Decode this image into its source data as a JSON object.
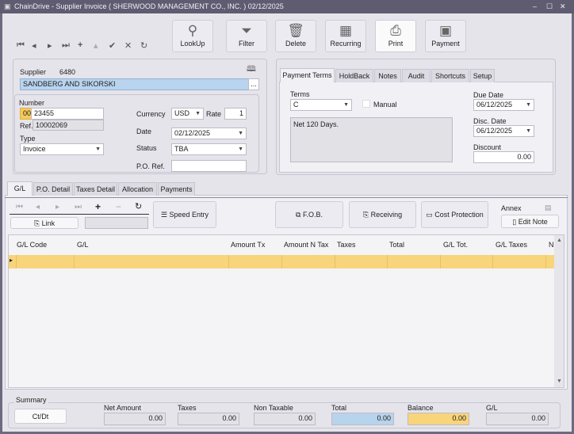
{
  "window": {
    "title": "ChainDrive - Supplier Invoice ( SHERWOOD MANAGEMENT CO., INC. ) 02/12/2025",
    "controls": [
      "–",
      "☐",
      "✕"
    ]
  },
  "toolbar": {
    "nav_icons": [
      "first",
      "previous",
      "next",
      "last",
      "add",
      "up",
      "confirm",
      "cancel",
      "refresh"
    ],
    "nav_glyphs": [
      "⏮",
      "◂",
      "▸",
      "⏭",
      "+",
      "▴",
      "✔",
      "✕",
      "↻"
    ],
    "buttons": [
      {
        "label": "LookUp",
        "icon": "search-icon",
        "glyph": "⚲"
      },
      {
        "label": "Filter",
        "icon": "filter-icon",
        "glyph": "⏷"
      },
      {
        "label": "Delete",
        "icon": "trash-icon",
        "glyph": "🗑"
      },
      {
        "label": "Recurring",
        "icon": "calendar-icon",
        "glyph": "▦"
      },
      {
        "label": "Print",
        "icon": "printer-icon",
        "glyph": "⎙"
      },
      {
        "label": "Payment",
        "icon": "payment-icon",
        "glyph": "▣"
      }
    ]
  },
  "supplier": {
    "label": "Supplier",
    "code": "6480",
    "name": "SANDBERG AND SIKORSKI",
    "browse": "..."
  },
  "invoice": {
    "number_label": "Number",
    "prefix": "00",
    "number": "23455",
    "ref_label": "Ref.",
    "ref": "10002069",
    "type_label": "Type",
    "type": "Invoice",
    "currency_label": "Currency",
    "currency": "USD",
    "rate_label": "Rate",
    "rate": "1",
    "date_label": "Date",
    "date": "02/12/2025",
    "status_label": "Status",
    "status": "TBA",
    "po_ref_label": "P.O. Ref.",
    "po_ref": ""
  },
  "top_tabs": [
    "Payment Terms",
    "HoldBack",
    "Notes",
    "Audit",
    "Shortcuts",
    "Setup"
  ],
  "terms": {
    "terms_label": "Terms",
    "terms": "C",
    "manual_label": "Manual",
    "manual": false,
    "description": "Net 120 Days.",
    "due_date_label": "Due Date",
    "due_date": "06/12/2025",
    "disc_date_label": "Disc. Date",
    "disc_date": "06/12/2025",
    "discount_label": "Discount",
    "discount": "0.00"
  },
  "bottom_tabs": [
    "G/L",
    "P.O. Detail",
    "Taxes Detail",
    "Allocation",
    "Payments"
  ],
  "gl": {
    "nav_glyphs": [
      "⏮",
      "◂",
      "▸",
      "⏭",
      "+",
      "−",
      "↻"
    ],
    "link_label": "Link",
    "speed_entry": "Speed Entry",
    "fob": "F.O.B.",
    "receiving": "Receiving",
    "cost_protection": "Cost Protection",
    "annex_label": "Annex",
    "edit_note": "Edit Note",
    "columns": [
      "G/L Code",
      "G/L",
      "Amount Tx",
      "Amount N Tax",
      "Taxes",
      "Total",
      "G/L Tot.",
      "G/L Taxes",
      "N"
    ],
    "row_color": "#f8d47a"
  },
  "summary": {
    "label": "Summary",
    "ctdt": "Ct/Dt",
    "fields": [
      {
        "label": "Net Amount",
        "value": "0.00"
      },
      {
        "label": "Taxes",
        "value": "0.00"
      },
      {
        "label": "Non Taxable",
        "value": "0.00"
      },
      {
        "label": "Total",
        "value": "0.00",
        "color": "#b8d3ec"
      },
      {
        "label": "Balance",
        "value": "0.00",
        "color": "#f8d47a"
      },
      {
        "label": "G/L",
        "value": "0.00"
      }
    ]
  }
}
